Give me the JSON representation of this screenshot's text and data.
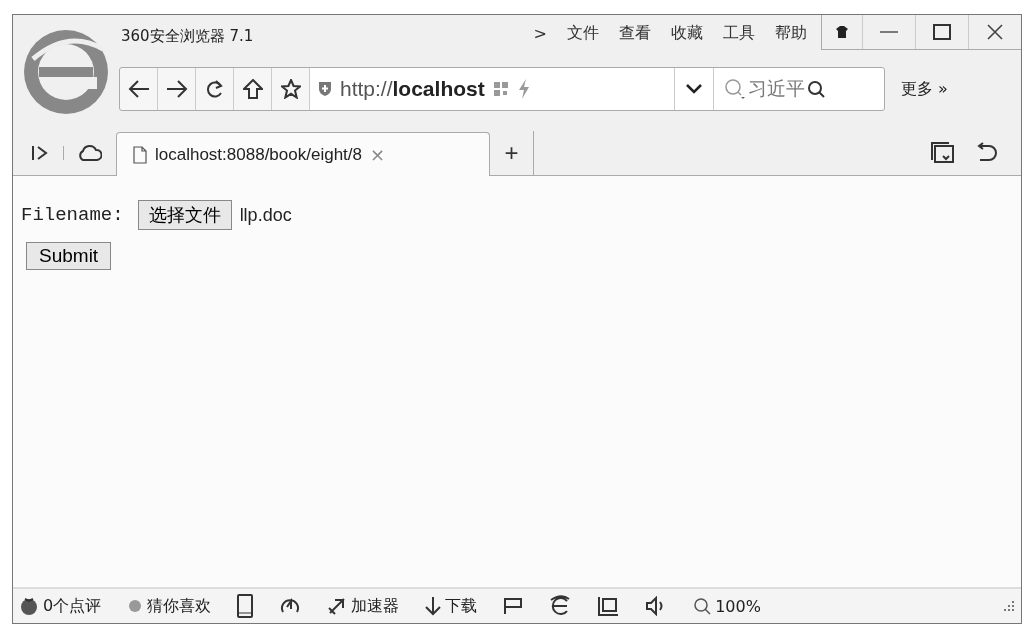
{
  "window": {
    "title": "360安全浏览器 7.1"
  },
  "menu": {
    "expander": ">",
    "items": [
      "文件",
      "查看",
      "收藏",
      "工具",
      "帮助"
    ]
  },
  "toolbar": {
    "address": "http://**localhost**",
    "search": "习近平",
    "more": "更多 »"
  },
  "tabs": [
    {
      "label": "localhost:8088/book/eight/8",
      "close": "×",
      "selected": true
    }
  ],
  "new_tab": "+",
  "page": {
    "label": "Filename:",
    "file_button": "选择文件",
    "file_name": "llp.doc",
    "submit": "Submit"
  },
  "status_bar": [
    {
      "kind": "rating",
      "label": "0个点评"
    },
    {
      "kind": "guess",
      "label": "猜你喜欢"
    },
    {
      "kind": "phone"
    },
    {
      "kind": "speed"
    },
    {
      "kind": "accelerator",
      "label": "加速器"
    },
    {
      "kind": "download",
      "label": "下载"
    },
    {
      "kind": "flag"
    },
    {
      "kind": "ie"
    },
    {
      "kind": "window"
    },
    {
      "kind": "sound"
    },
    {
      "kind": "zoom",
      "label": "100%"
    }
  ]
}
